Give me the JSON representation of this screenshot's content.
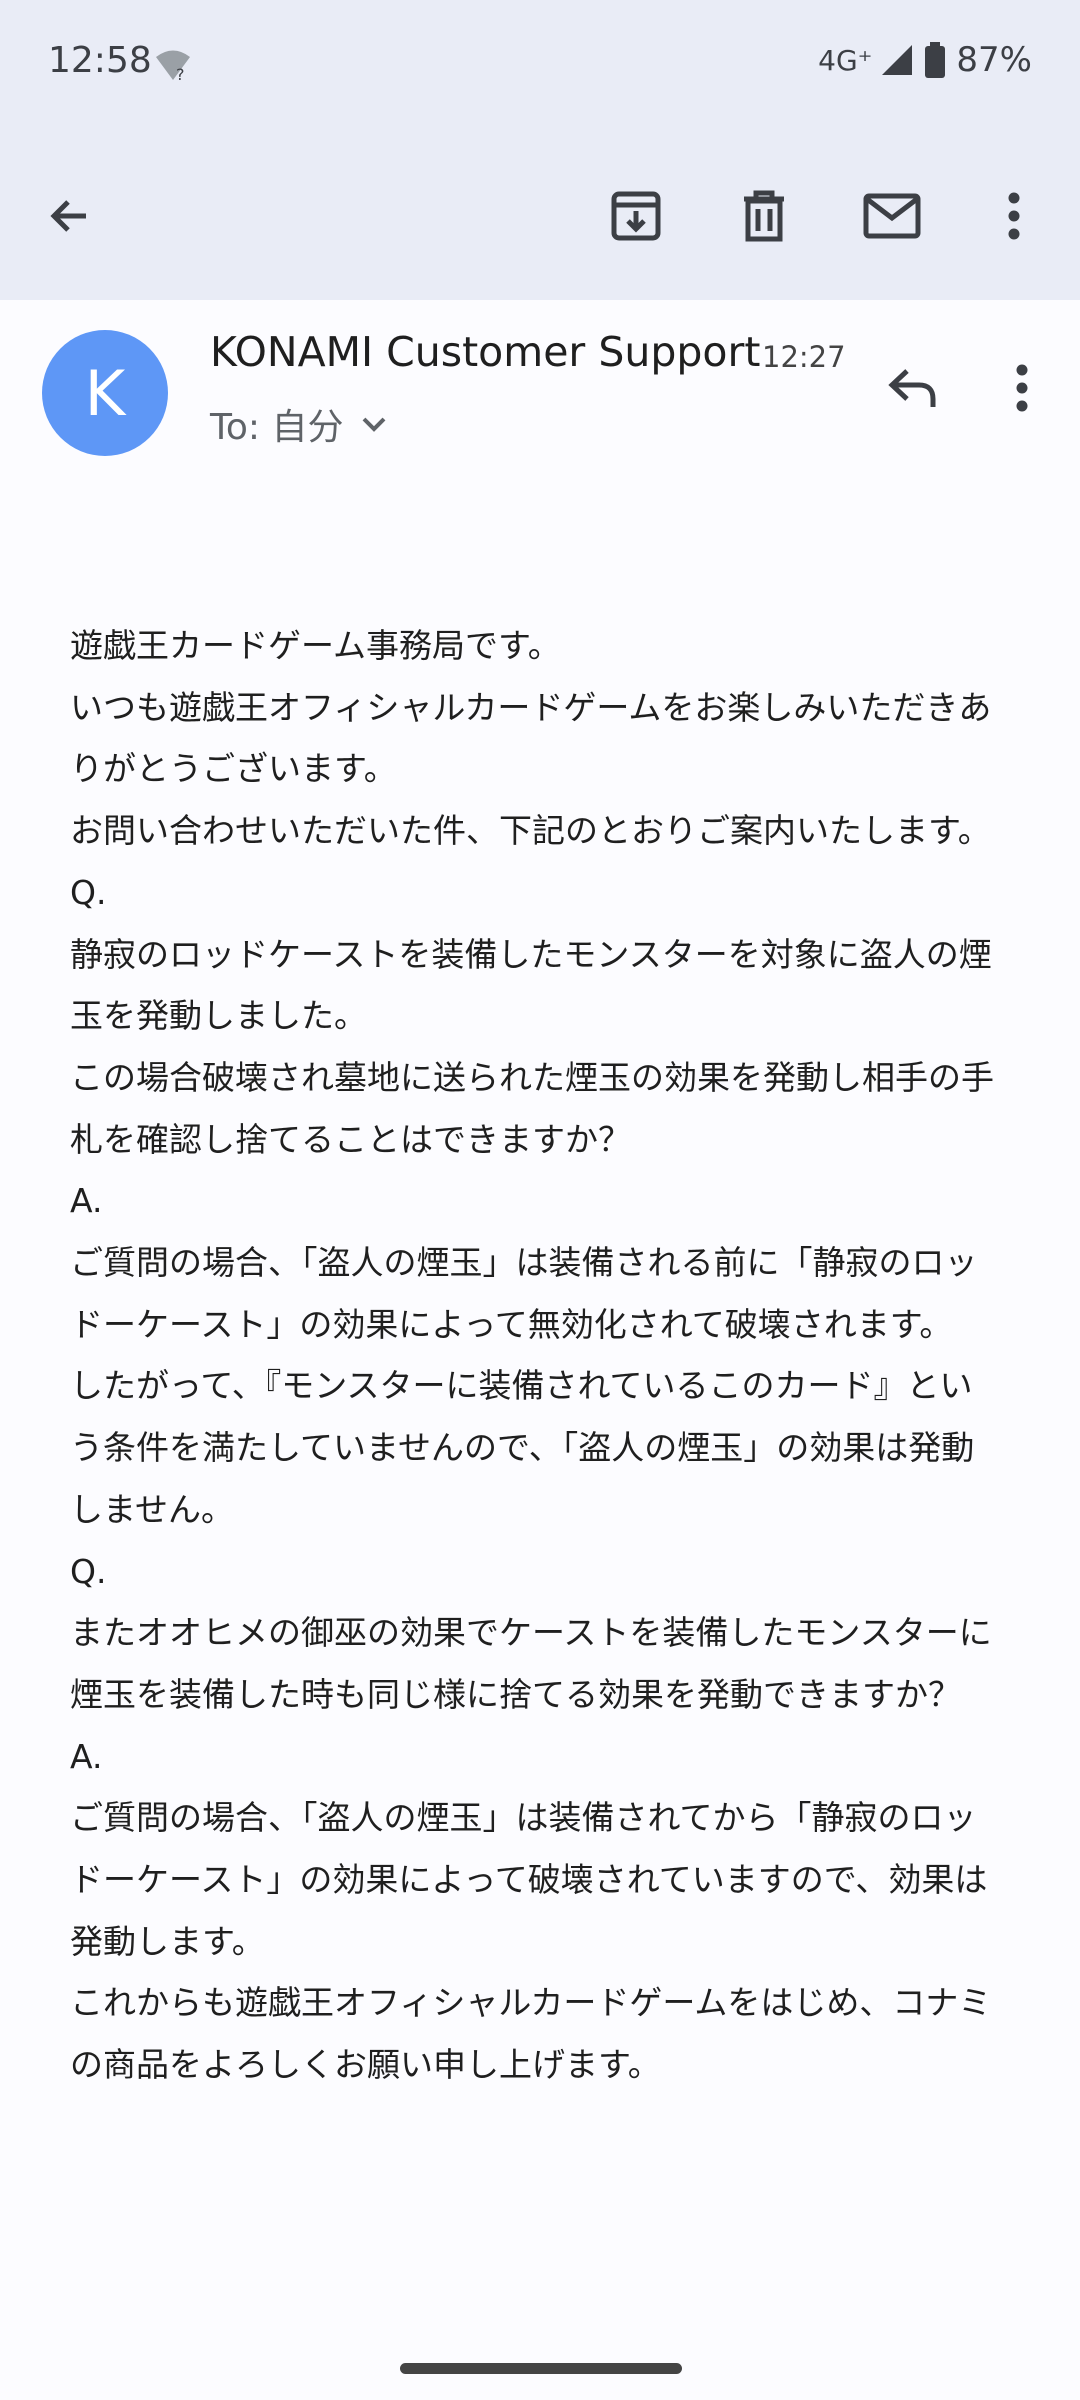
{
  "status": {
    "time": "12:58",
    "wifi_badge": "?",
    "network": "4G⁺",
    "battery": "87%"
  },
  "toolbar": {
    "back_icon": "arrow-back-icon",
    "archive_icon": "archive-icon",
    "delete_icon": "trash-icon",
    "mark_unread_icon": "mail-icon",
    "more_icon": "more-vert-icon"
  },
  "email": {
    "avatar_letter": "K",
    "sender": "KONAMI Customer Support",
    "time": "12:27",
    "to_label": "To: 自分"
  },
  "body_lines": [
    "遊戯王カードゲーム事務局です。",
    "",
    "いつも遊戯王オフィシャルカードゲームをお楽しみいただきあ",
    "りがとうございます。",
    "お問い合わせいただいた件、下記のとおりご案内いたします。",
    "",
    "Q.",
    "静寂のロッドケーストを装備したモンスターを対象に盗人の煙",
    "玉を発動しました。",
    "この場合破壊され墓地に送られた煙玉の効果を発動し相手の手",
    "札を確認し捨てることはできますか？",
    "A.",
    "ご質問の場合、「盗人の煙玉」は装備される前に「静寂のロッ",
    "ドーケースト」の効果によって無効化されて破壊されます。",
    "したがって、『モンスターに装備されているこのカード』とい",
    "う条件を満たしていませんので、「盗人の煙玉」の効果は発動",
    "しません。",
    "",
    "Q.",
    "またオオヒメの御巫の効果でケーストを装備したモンスターに",
    "煙玉を装備した時も同じ様に捨てる効果を発動できますか？",
    "A.",
    "ご質問の場合、「盗人の煙玉」は装備されてから「静寂のロッ",
    "ドーケースト」の効果によって破壊されていますので、効果は",
    "発動します。",
    "",
    "これからも遊戯王オフィシャルカードゲームをはじめ、コナミ",
    "の商品をよろしくお願い申し上げます。"
  ]
}
